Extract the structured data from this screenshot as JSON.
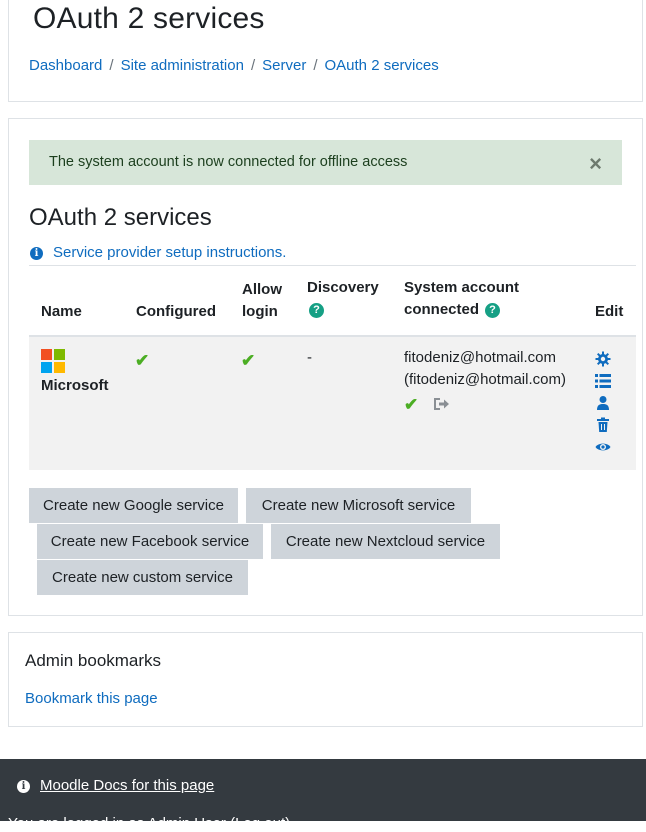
{
  "header": {
    "title": "OAuth 2 services",
    "breadcrumb": [
      "Dashboard",
      "Site administration",
      "Server",
      "OAuth 2 services"
    ],
    "separator": "/"
  },
  "alert": {
    "message": "The system account is now connected for offline access",
    "close": "×",
    "color": "#d7e6d9"
  },
  "section": {
    "title": "OAuth 2 services",
    "setup_link": "Service provider setup instructions."
  },
  "table": {
    "headers": {
      "name": "Name",
      "configured": "Configured",
      "allow_login": "Allow login",
      "discovery": "Discovery",
      "system_account": "System account connected",
      "edit": "Edit"
    },
    "rows": [
      {
        "name": "Microsoft",
        "configured": "✔",
        "allow_login": "✔",
        "discovery": "-",
        "system_account_email": "fitodeniz@hotmail.com",
        "system_account_paren": "(fitodeniz@hotmail.com)",
        "system_account_connected": "✔",
        "edit_icons": [
          "gear-icon",
          "list-icon",
          "user-icon",
          "trash-icon",
          "eye-icon"
        ]
      }
    ]
  },
  "buttons": {
    "google": "Create new Google service",
    "microsoft": "Create new Microsoft service",
    "facebook": "Create new Facebook service",
    "nextcloud": "Create new Nextcloud service",
    "custom": "Create new custom service"
  },
  "bookmarks": {
    "title": "Admin bookmarks",
    "link": "Bookmark this page"
  },
  "footer": {
    "docs_link": "Moodle Docs for this page",
    "login_text": "You are logged in as Admin User (Log out)"
  },
  "colors": {
    "link": "#0f6cbf",
    "check": "#4cae24",
    "help": "#16a085",
    "footer": "#343a40",
    "button": "#ced4da"
  }
}
